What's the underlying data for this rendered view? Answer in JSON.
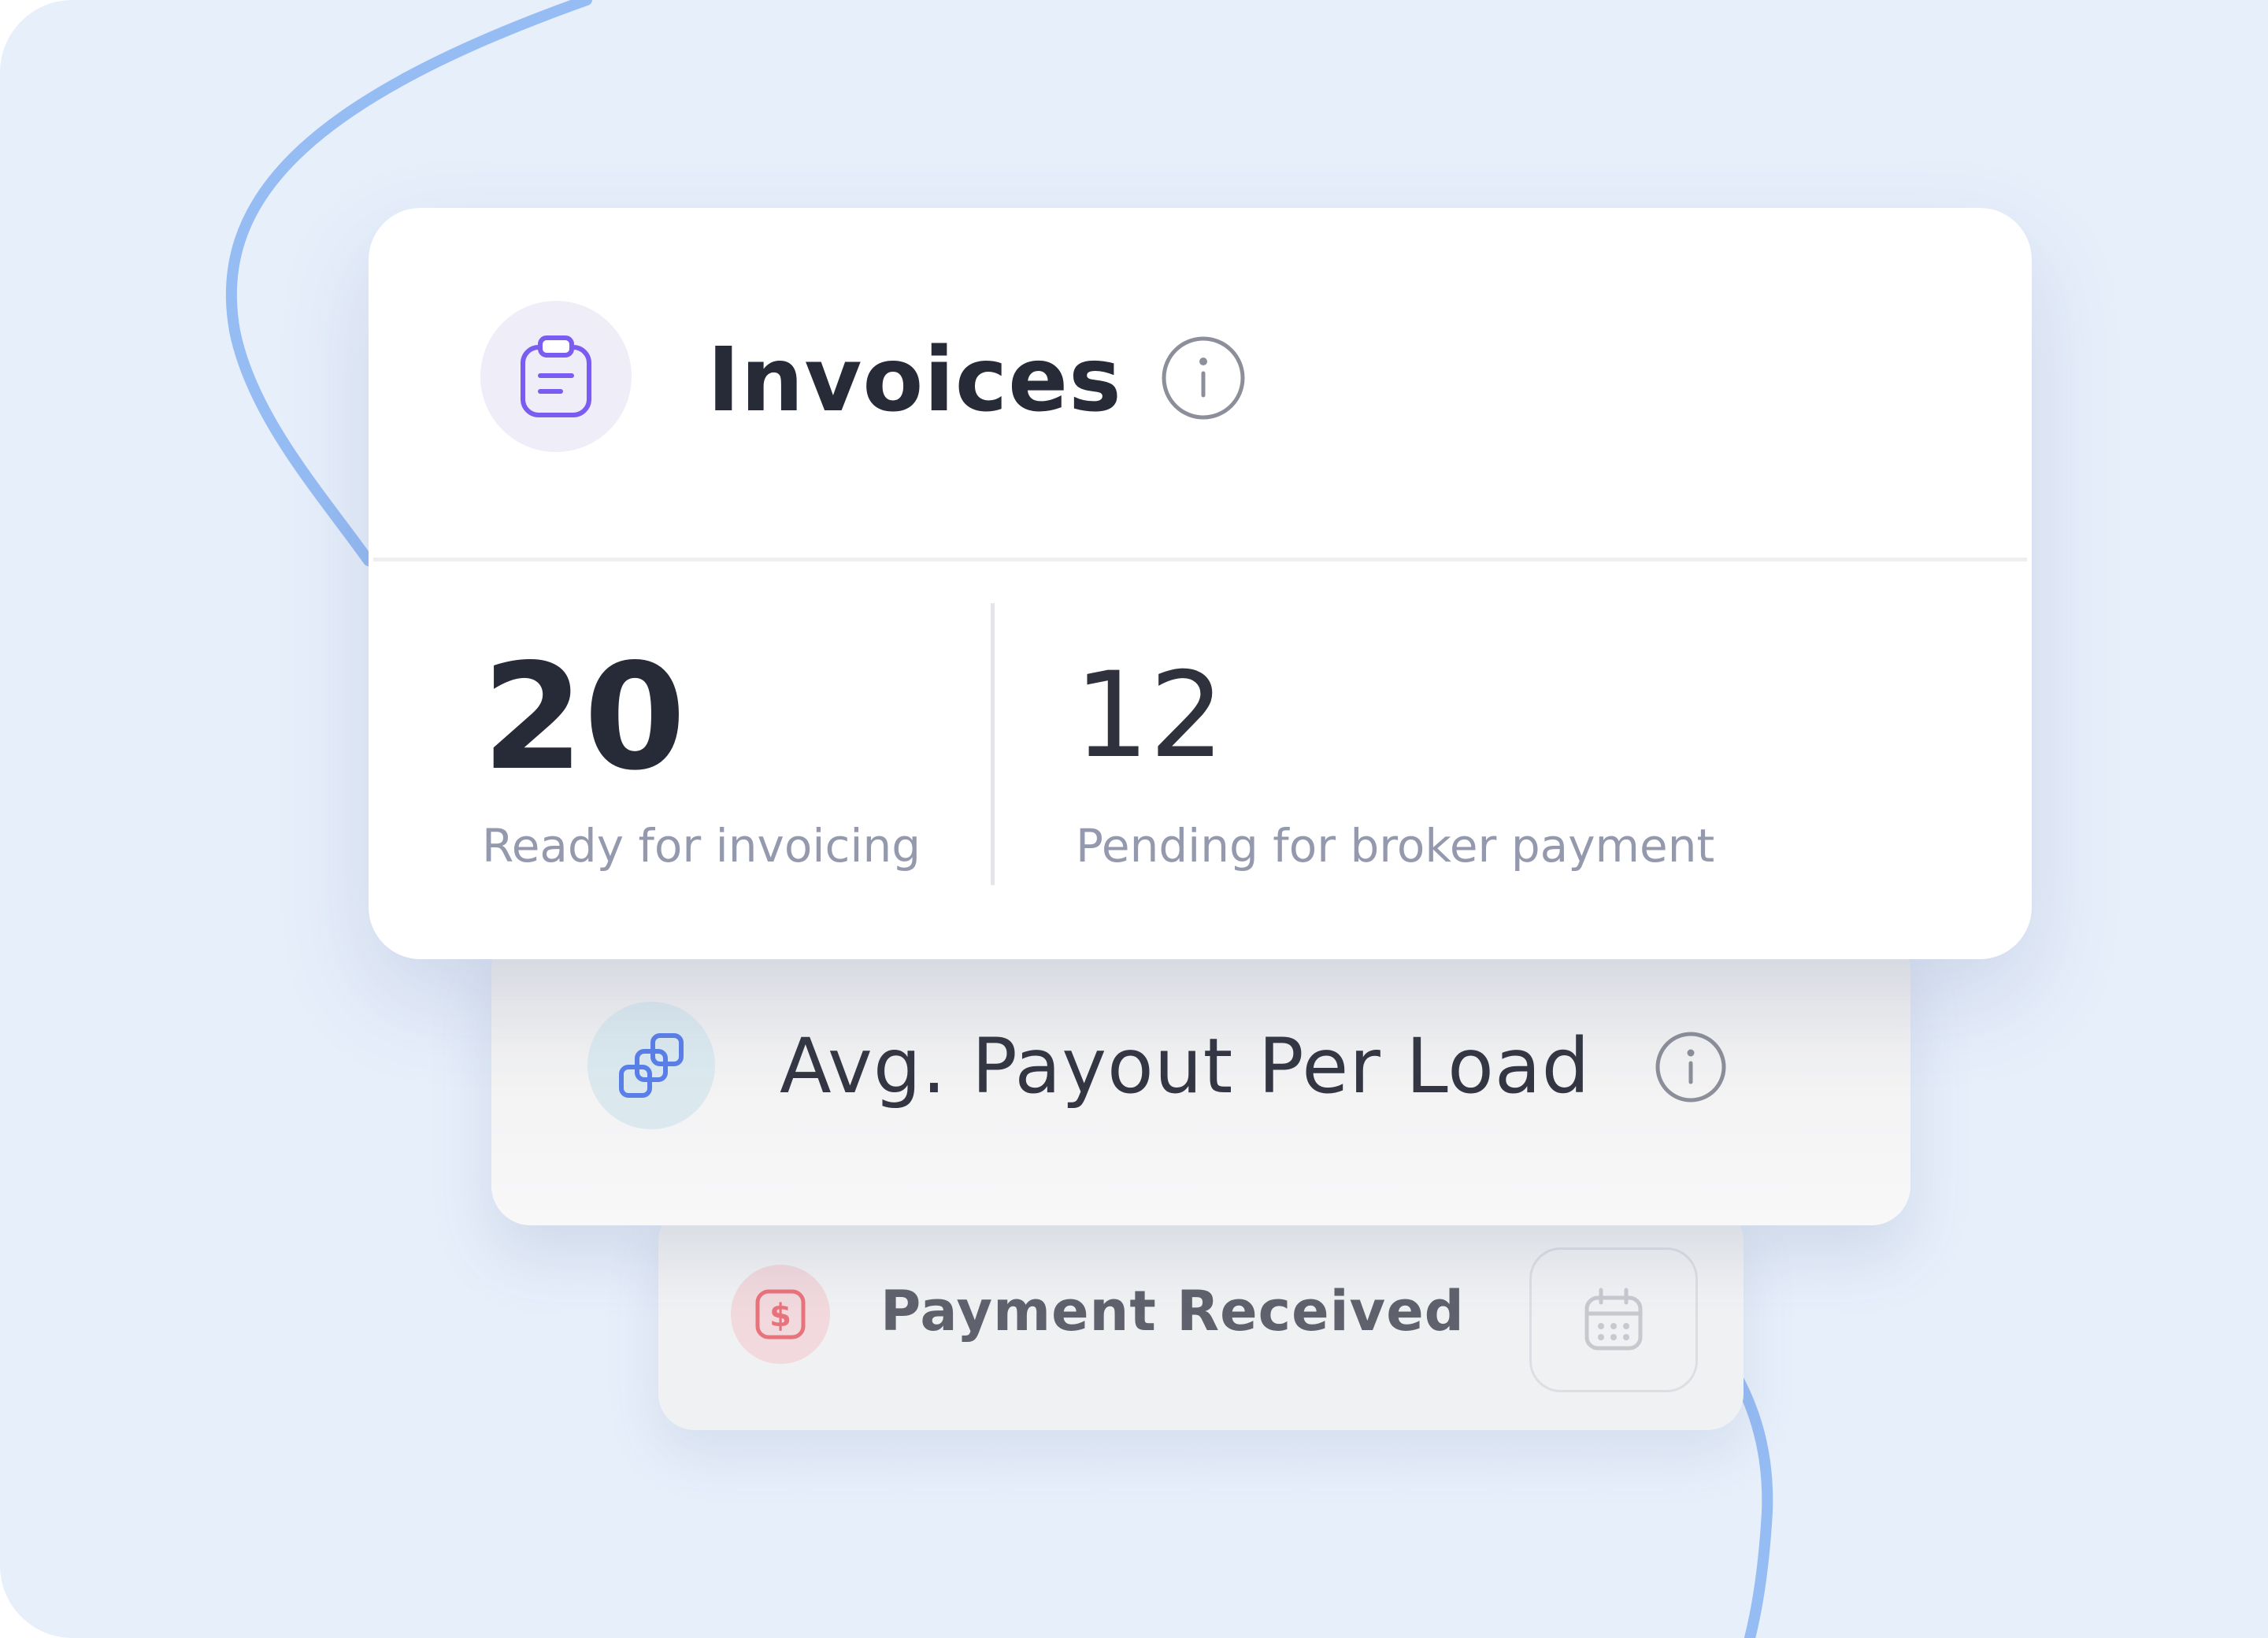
{
  "colors": {
    "background": "#e7effb",
    "accent_line": "#96bcf4",
    "invoice_icon": "#7a5cf0",
    "payout_icon": "#5b7fe8",
    "payment_icon": "#e8737c"
  },
  "invoices": {
    "title": "Invoices",
    "icon": "clipboard-icon",
    "stats": [
      {
        "value": "20",
        "label": "Ready for invoicing"
      },
      {
        "value": "12",
        "label": "Pending for broker payment"
      }
    ]
  },
  "payout": {
    "title": "Avg. Payout Per Load",
    "icon": "connected-squares-icon"
  },
  "payment": {
    "title": "Payment Received",
    "icon": "dollar-icon",
    "action_icon": "calendar-icon"
  }
}
